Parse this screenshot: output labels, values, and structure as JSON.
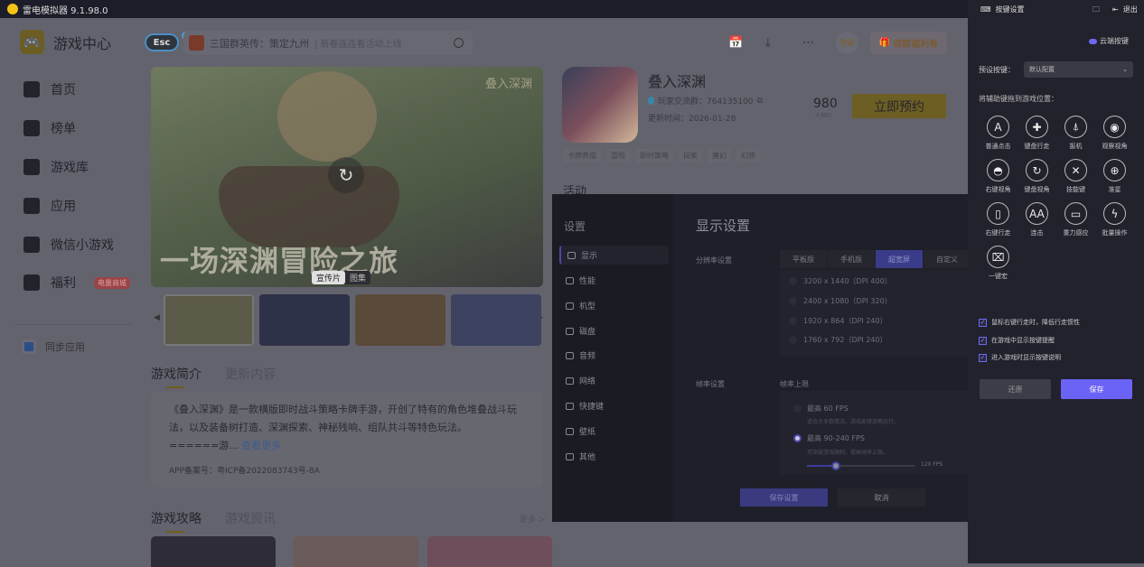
{
  "app": {
    "title": "雷电模拟器 9.1.98.0"
  },
  "sidebar": {
    "brand": "游戏中心",
    "items": [
      {
        "label": "首页"
      },
      {
        "label": "榜单"
      },
      {
        "label": "游戏库"
      },
      {
        "label": "应用"
      },
      {
        "label": "微信小游戏"
      },
      {
        "label": "福利",
        "badge": "电量商城"
      }
    ],
    "sync": "同步应用"
  },
  "header": {
    "esc": "Esc",
    "search_title": "三国群英传：策定九州",
    "search_sub": "| 新春连连看活动上线",
    "login": "登录",
    "coupon": "领取福利券"
  },
  "banner": {
    "title": "一场深渊冒险之旅",
    "logo": "叠入深渊",
    "tabs": [
      "宣传片",
      "图集"
    ]
  },
  "game": {
    "name": "叠入深渊",
    "group": "玩家交流群：764135100",
    "updated": "更新时间：2026-01-28",
    "count": "980",
    "count_label": "人预约",
    "reserve": "立即预约",
    "tags": [
      "卡牌养成",
      "冒险",
      "即时策略",
      "探索",
      "魔幻",
      "幻想"
    ],
    "activity": "活动"
  },
  "intro": {
    "tabs": [
      "游戏简介",
      "更新内容"
    ],
    "text": "《叠入深渊》是一款横版即时战斗策略卡牌手游，开创了特有的角色堆叠战斗玩法，以及装备树打造、深渊探索、神秘残响、组队共斗等特色玩法。",
    "trunc": "======游...",
    "more": "查看更多",
    "icp": "APP备案号：粤ICP备2022083743号-8A"
  },
  "guides": {
    "tabs": [
      "游戏攻略",
      "游戏资讯"
    ],
    "more": "更多 >"
  },
  "settings": {
    "title": "设置",
    "heading": "显示设置",
    "menu": [
      "显示",
      "性能",
      "机型",
      "磁盘",
      "音频",
      "网络",
      "快捷键",
      "壁纸",
      "其他"
    ],
    "res_label": "分辨率设置",
    "res_tabs": [
      "平板版",
      "手机版",
      "超宽屏",
      "自定义"
    ],
    "res_options": [
      "3200 x 1440（DPI 400）",
      "2400 x 1080（DPI 320）",
      "1920 x 864（DPI 240）",
      "1760 x 792（DPI 240）"
    ],
    "fps_label": "帧率设置",
    "fps_cap": "帧率上限",
    "fps_options": [
      {
        "label": "最高 60 FPS",
        "desc": "适合大多数情况，游戏能够流畅运行。"
      },
      {
        "label": "最高 90-240 FPS",
        "desc": "可突破游戏限制，提高帧率上限。"
      }
    ],
    "fps_value": "120 FPS",
    "fps_slider_fraction": 0.27,
    "save": "保存设置",
    "cancel": "取消"
  },
  "keypanel": {
    "title": "按键设置",
    "exit": "退出",
    "cloud": "云端按键",
    "preset_label": "预设按键：",
    "preset_value": "默认配置",
    "drag_hint": "将辅助键拖到游戏位置：",
    "keys": [
      {
        "label": "普通点击",
        "glyph": "A"
      },
      {
        "label": "键盘行走",
        "glyph": "✚"
      },
      {
        "label": "扳机",
        "glyph": "⍋"
      },
      {
        "label": "观察视角",
        "glyph": "◉"
      },
      {
        "label": "右键视角",
        "glyph": "◓"
      },
      {
        "label": "键盘视角",
        "glyph": "↻"
      },
      {
        "label": "技能键",
        "glyph": "✕"
      },
      {
        "label": "准星",
        "glyph": "⊕"
      },
      {
        "label": "右键行走",
        "glyph": "▯"
      },
      {
        "label": "连击",
        "glyph": "AA"
      },
      {
        "label": "重力感应",
        "glyph": "▭"
      },
      {
        "label": "批量操作",
        "glyph": "ϟ"
      },
      {
        "label": "一键宏",
        "glyph": "⌧"
      }
    ],
    "checks": [
      "鼠标右键行走时，降低行走惯性",
      "在游戏中显示按键提醒",
      "进入游戏时显示按键说明"
    ],
    "reset": "还原",
    "save": "保存"
  }
}
